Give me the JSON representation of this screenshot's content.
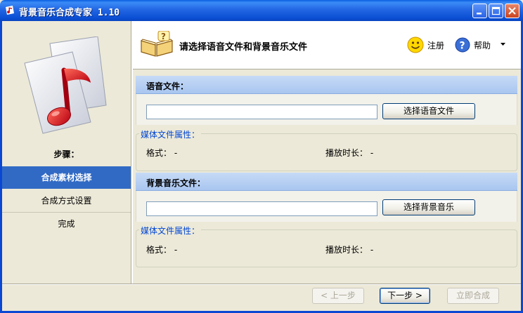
{
  "window": {
    "title": "背景音乐合成专家  1.10"
  },
  "sidebar": {
    "steps_label": "步骤：",
    "steps": [
      {
        "label": "合成素材选择",
        "active": true
      },
      {
        "label": "合成方式设置",
        "active": false
      },
      {
        "label": "完成",
        "active": false
      }
    ]
  },
  "header": {
    "title": "请选择语音文件和背景音乐文件",
    "register_label": "注册",
    "help_label": "帮助"
  },
  "voice": {
    "section_title": "语音文件：",
    "path_value": "",
    "choose_button": "选择语音文件",
    "props_legend": "媒体文件属性：",
    "format_label": "格式：",
    "format_value": "-",
    "duration_label": "播放时长：",
    "duration_value": "-"
  },
  "music": {
    "section_title": "背景音乐文件：",
    "path_value": "",
    "choose_button": "选择背景音乐",
    "props_legend": "媒体文件属性：",
    "format_label": "格式：",
    "format_value": "-",
    "duration_label": "播放时长：",
    "duration_value": "-"
  },
  "footer": {
    "prev_button": "< 上一步",
    "next_button": "下一步 >",
    "compose_button": "立即合成"
  },
  "colors": {
    "titlebar": "#0b4fd4",
    "active_step": "#316ac5",
    "section_header": "#b4cdf2",
    "legend_text": "#0046d5"
  }
}
